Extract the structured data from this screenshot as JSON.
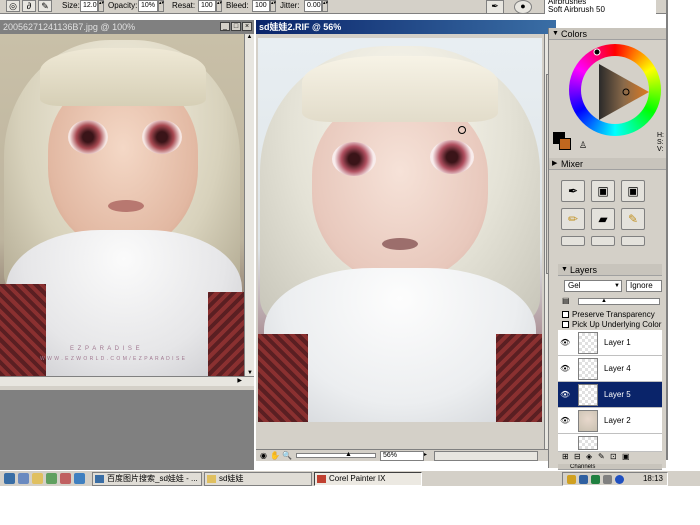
{
  "property_bar": {
    "size_label": "Size:",
    "size_value": "12.0",
    "opacity_label": "Opacity:",
    "opacity_value": "10%",
    "resat_label": "Resat:",
    "resat_value": "100",
    "bleed_label": "Bleed:",
    "bleed_value": "100",
    "jitter_label": "Jitter:",
    "jitter_value": "0.00",
    "brush_category": "Airbrushes",
    "brush_variant": "Soft Airbrush 50"
  },
  "doc1": {
    "title": "20056271241136B7.jpg @ 100%",
    "watermark_line1": "E Z P A R A D I S E",
    "watermark_line2": "W W W . E Z W O R L D . C O M / E Z P A R A D I S E"
  },
  "doc2": {
    "title": "sd娃娃2.RIF @ 56%",
    "zoom_value": "56%"
  },
  "colors_panel": {
    "title": "Colors",
    "hsv_h": "H:",
    "hsv_s": "S:",
    "hsv_v": "V:",
    "primary_color": "#c0671f",
    "wheel_accent": "#e07a1e"
  },
  "mixer_panel": {
    "title": "Mixer"
  },
  "layers_panel": {
    "title": "Layers",
    "composite_method": "Gel",
    "ignore_label": "Ignore",
    "preserve_transparency": "Preserve Transparency",
    "pick_up_underlying": "Pick Up Underlying Color",
    "layers": [
      {
        "name": "Layer 1",
        "selected": false
      },
      {
        "name": "Layer 4",
        "selected": false
      },
      {
        "name": "Layer 5",
        "selected": true
      },
      {
        "name": "Layer 2",
        "selected": false
      }
    ],
    "next_panel": "Channels"
  },
  "taskbar": {
    "tasks": [
      {
        "label": "百度图片搜索_sd娃娃 - ..."
      },
      {
        "label": "sd娃娃"
      },
      {
        "label": "Corel Painter IX"
      }
    ],
    "clock": "18:13"
  }
}
